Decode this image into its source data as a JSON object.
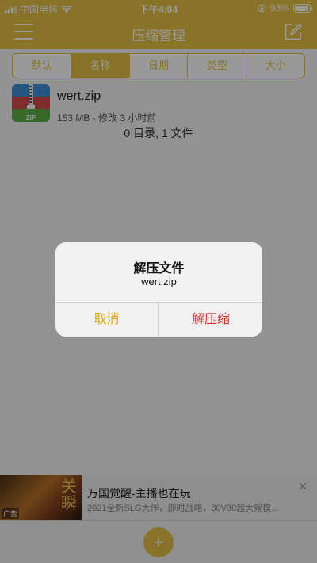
{
  "status_bar": {
    "carrier": "中国电信",
    "time": "下午4:04",
    "battery_percent": "93%",
    "battery_level": 0.93
  },
  "nav": {
    "title": "压缩管理",
    "menu_icon": "hamburger-menu-icon",
    "edit_icon": "edit-icon"
  },
  "sort_tabs": [
    {
      "label": "默认",
      "active": false
    },
    {
      "label": "名称",
      "active": true
    },
    {
      "label": "日期",
      "active": false
    },
    {
      "label": "类型",
      "active": false
    },
    {
      "label": "大小",
      "active": false
    }
  ],
  "file": {
    "name": "wert.zip",
    "meta": "153 MB - 修改 3 小时前",
    "icon": "zip-archive-icon",
    "icon_label": "ZIP"
  },
  "summary": "0 目录, 1 文件",
  "dialog": {
    "title": "解压文件",
    "message": "wert.zip",
    "cancel_label": "取消",
    "confirm_label": "解压缩"
  },
  "ad": {
    "title": "万国觉醒-主播也在玩",
    "description": "2021全新SLG大作，即时战略，30V30超大规模...",
    "tag": "广告"
  },
  "bottom": {
    "add_icon": "plus-icon",
    "add_symbol": "+"
  },
  "colors": {
    "accent": "#e3c044",
    "cancel": "#e3a30f",
    "destructive": "#e0302c"
  }
}
